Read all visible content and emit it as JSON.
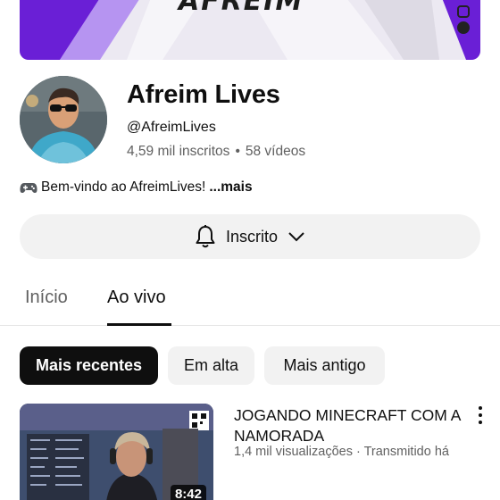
{
  "banner": {
    "logo_text": "AFREIM",
    "accent_color": "#6a1fd6"
  },
  "channel": {
    "name": "Afreim Lives",
    "handle": "@AfreimLives",
    "subscribers": "4,59 mil inscritos",
    "separator": "•",
    "videos": "58 vídeos",
    "description": "Bem-vindo ao AfreimLives!",
    "more_label": "...mais",
    "description_icon": "gamepad-icon"
  },
  "subscribe": {
    "label": "Inscrito",
    "bell_icon": "bell-icon",
    "chevron_icon": "chevron-down-icon"
  },
  "tabs": [
    {
      "label": "Início",
      "active": false
    },
    {
      "label": "Ao vivo",
      "active": true
    }
  ],
  "chips": [
    {
      "label": "Mais recentes",
      "selected": true
    },
    {
      "label": "Em alta",
      "selected": false
    },
    {
      "label": "Mais antigo",
      "selected": false
    }
  ],
  "video": {
    "title": "JOGANDO MINECRAFT COM A NAMORADA",
    "meta": "1,4 mil visualizações · Transmitido há",
    "duration": "8:42",
    "menu_icon": "more-vert-icon"
  }
}
